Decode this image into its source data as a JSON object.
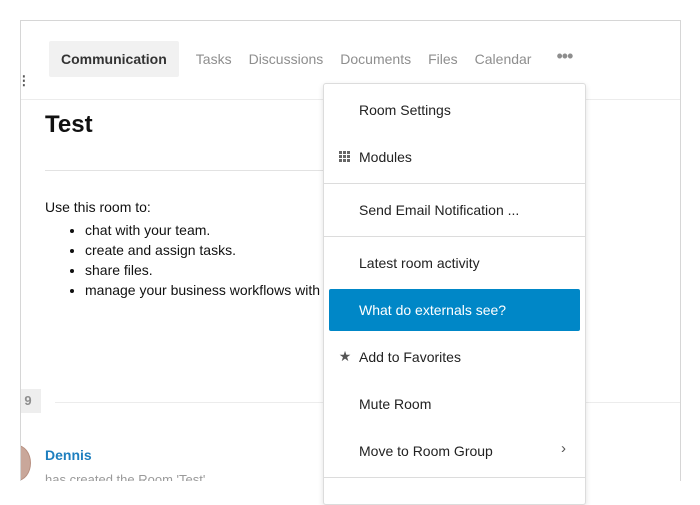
{
  "tabs": {
    "items": [
      "Communication",
      "Tasks",
      "Discussions",
      "Documents",
      "Files",
      "Calendar"
    ],
    "more": "•••"
  },
  "room": {
    "title": "Test",
    "intro": "Use this room to:",
    "uses": [
      "chat with your team.",
      "create and assign tasks.",
      "share files.",
      "manage your business workflows with"
    ]
  },
  "feed": {
    "date_badge": "9",
    "author": "Dennis",
    "activity": "has created the Room 'Test'"
  },
  "menu": {
    "items": [
      {
        "label": "Room Settings",
        "icon": ""
      },
      {
        "label": "Modules",
        "icon": "grid-icon"
      },
      {
        "label": "Send Email Notification ...",
        "icon": ""
      },
      {
        "label": "Latest room activity",
        "icon": ""
      },
      {
        "label": "What do externals see?",
        "icon": "",
        "highlighted": true
      },
      {
        "label": "Add to Favorites",
        "icon": "star-icon"
      },
      {
        "label": "Mute Room",
        "icon": ""
      },
      {
        "label": "Move to Room Group",
        "icon": "chevron-right-icon"
      }
    ],
    "star_glyph": "★",
    "chevron_glyph": "›"
  },
  "colors": {
    "accent": "#0087c7",
    "link": "#1e7fbf",
    "muted": "#8e8e8e"
  }
}
